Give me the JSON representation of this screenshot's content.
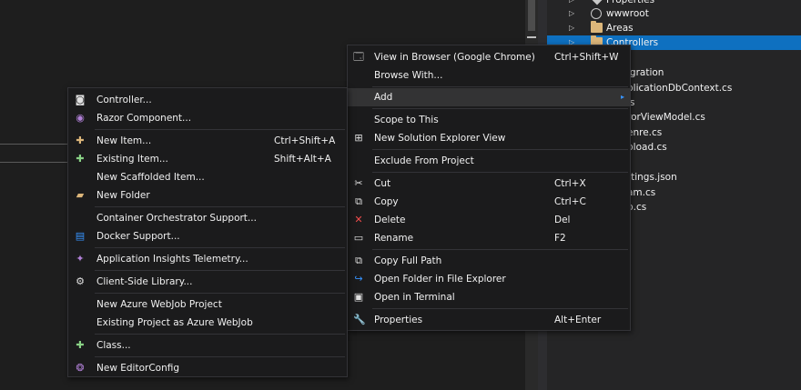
{
  "explorer": {
    "items": [
      {
        "label": "Properties",
        "icon": "wrench-icon"
      },
      {
        "label": "wwwroot",
        "icon": "globe-icon"
      },
      {
        "label": "Areas",
        "icon": "folder-icon"
      },
      {
        "label": "Controllers",
        "icon": "folder-icon",
        "selected": true
      }
    ],
    "partial_items": [
      "igration",
      "plicationDbContext.cs",
      "ls",
      "rorViewModel.cs",
      "enre.cs",
      "pload.cs",
      "ttings.json",
      "am.cs",
      "p.cs"
    ]
  },
  "context_menu": {
    "view_in_browser": {
      "label": "View in Browser (Google Chrome)",
      "shortcut": "Ctrl+Shift+W"
    },
    "browse_with": {
      "label": "Browse With..."
    },
    "add": {
      "label": "Add"
    },
    "scope_to_this": {
      "label": "Scope to This"
    },
    "new_solution_explorer_view": {
      "label": "New Solution Explorer View"
    },
    "exclude_from_project": {
      "label": "Exclude From Project"
    },
    "cut": {
      "label": "Cut",
      "shortcut": "Ctrl+X"
    },
    "copy": {
      "label": "Copy",
      "shortcut": "Ctrl+C"
    },
    "delete": {
      "label": "Delete",
      "shortcut": "Del"
    },
    "rename": {
      "label": "Rename",
      "shortcut": "F2"
    },
    "copy_full_path": {
      "label": "Copy Full Path"
    },
    "open_folder": {
      "label": "Open Folder in File Explorer"
    },
    "open_terminal": {
      "label": "Open in Terminal"
    },
    "properties": {
      "label": "Properties",
      "shortcut": "Alt+Enter"
    }
  },
  "add_menu": {
    "controller": {
      "label": "Controller..."
    },
    "razor_component": {
      "label": "Razor Component..."
    },
    "new_item": {
      "label": "New Item...",
      "shortcut": "Ctrl+Shift+A"
    },
    "existing_item": {
      "label": "Existing Item...",
      "shortcut": "Shift+Alt+A"
    },
    "new_scaffolded_item": {
      "label": "New Scaffolded Item..."
    },
    "new_folder": {
      "label": "New Folder"
    },
    "container_orchestrator": {
      "label": "Container Orchestrator Support..."
    },
    "docker_support": {
      "label": "Docker Support..."
    },
    "app_insights": {
      "label": "Application Insights Telemetry..."
    },
    "client_side_library": {
      "label": "Client-Side Library..."
    },
    "new_azure_webjob": {
      "label": "New Azure WebJob Project"
    },
    "existing_azure_webjob": {
      "label": "Existing Project as Azure WebJob"
    },
    "class": {
      "label": "Class..."
    },
    "new_editorconfig": {
      "label": "New EditorConfig"
    }
  },
  "colors": {
    "selection": "#0e70c0",
    "menu_bg": "#1b1b1c",
    "highlight": "#333334",
    "accent": "#3794ff"
  }
}
